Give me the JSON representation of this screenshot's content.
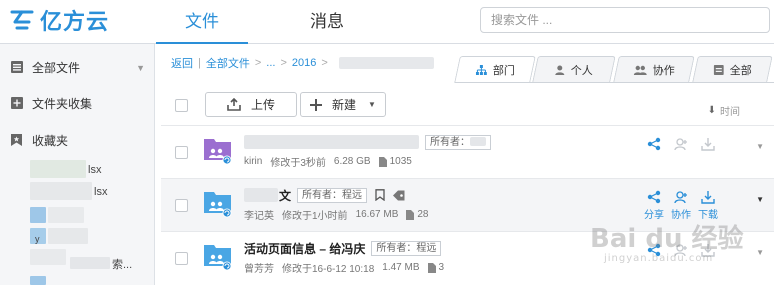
{
  "app": {
    "logo_text": "亿方云"
  },
  "top_nav": {
    "tabs": [
      {
        "label": "文件",
        "active": true
      },
      {
        "label": "消息",
        "active": false
      }
    ]
  },
  "search": {
    "placeholder": "搜索文件 ..."
  },
  "sidebar": {
    "items": [
      {
        "label": "全部文件",
        "icon": "list-icon"
      },
      {
        "label": "文件夹收集",
        "icon": "plus-square-icon"
      },
      {
        "label": "收藏夹",
        "icon": "bookmark-icon"
      }
    ],
    "tree_fragments": [
      "lsx",
      "lsx",
      "y",
      "索..."
    ]
  },
  "breadcrumb": {
    "items": [
      "返回",
      "全部文件",
      "...",
      "2016"
    ]
  },
  "filter_tabs": [
    {
      "label": "部门",
      "icon": "org-chart-icon",
      "active": true
    },
    {
      "label": "个人",
      "icon": "person-icon",
      "active": false
    },
    {
      "label": "协作",
      "icon": "group-icon",
      "active": false
    },
    {
      "label": "全部",
      "icon": "all-icon",
      "active": false
    }
  ],
  "toolbar": {
    "upload_label": "上传",
    "new_label": "新建",
    "sort_label": "时间"
  },
  "files": [
    {
      "name": "",
      "owner_label": "所有者：",
      "owner_name": "",
      "author": "kirin",
      "modified": "修改于3秒前",
      "size": "6.28 GB",
      "count": "1035",
      "folder_color": "#9b6fd0"
    },
    {
      "name": "文",
      "owner_label": "所有者：程远",
      "owner_name": "",
      "author": "李记英",
      "modified": "修改于1小时前",
      "size": "16.67 MB",
      "count": "28",
      "folder_color": "#4aa6e4",
      "actions_labels": [
        "分享",
        "协作",
        "下载"
      ]
    },
    {
      "name": "活动页面信息 – 给冯庆",
      "owner_label": "所有者：程远",
      "owner_name": "",
      "author": "曾芳芳",
      "modified": "修改于16-6-12 10:18",
      "size": "1.47 MB",
      "count": "3",
      "folder_color": "#4aa6e4"
    }
  ],
  "watermark": {
    "main": "Bai du 经验",
    "sub": "jingyan.baidu.com"
  },
  "colors": {
    "accent": "#2a8fd8",
    "purple_folder": "#9b6fd0",
    "blue_folder": "#4aa6e4"
  }
}
